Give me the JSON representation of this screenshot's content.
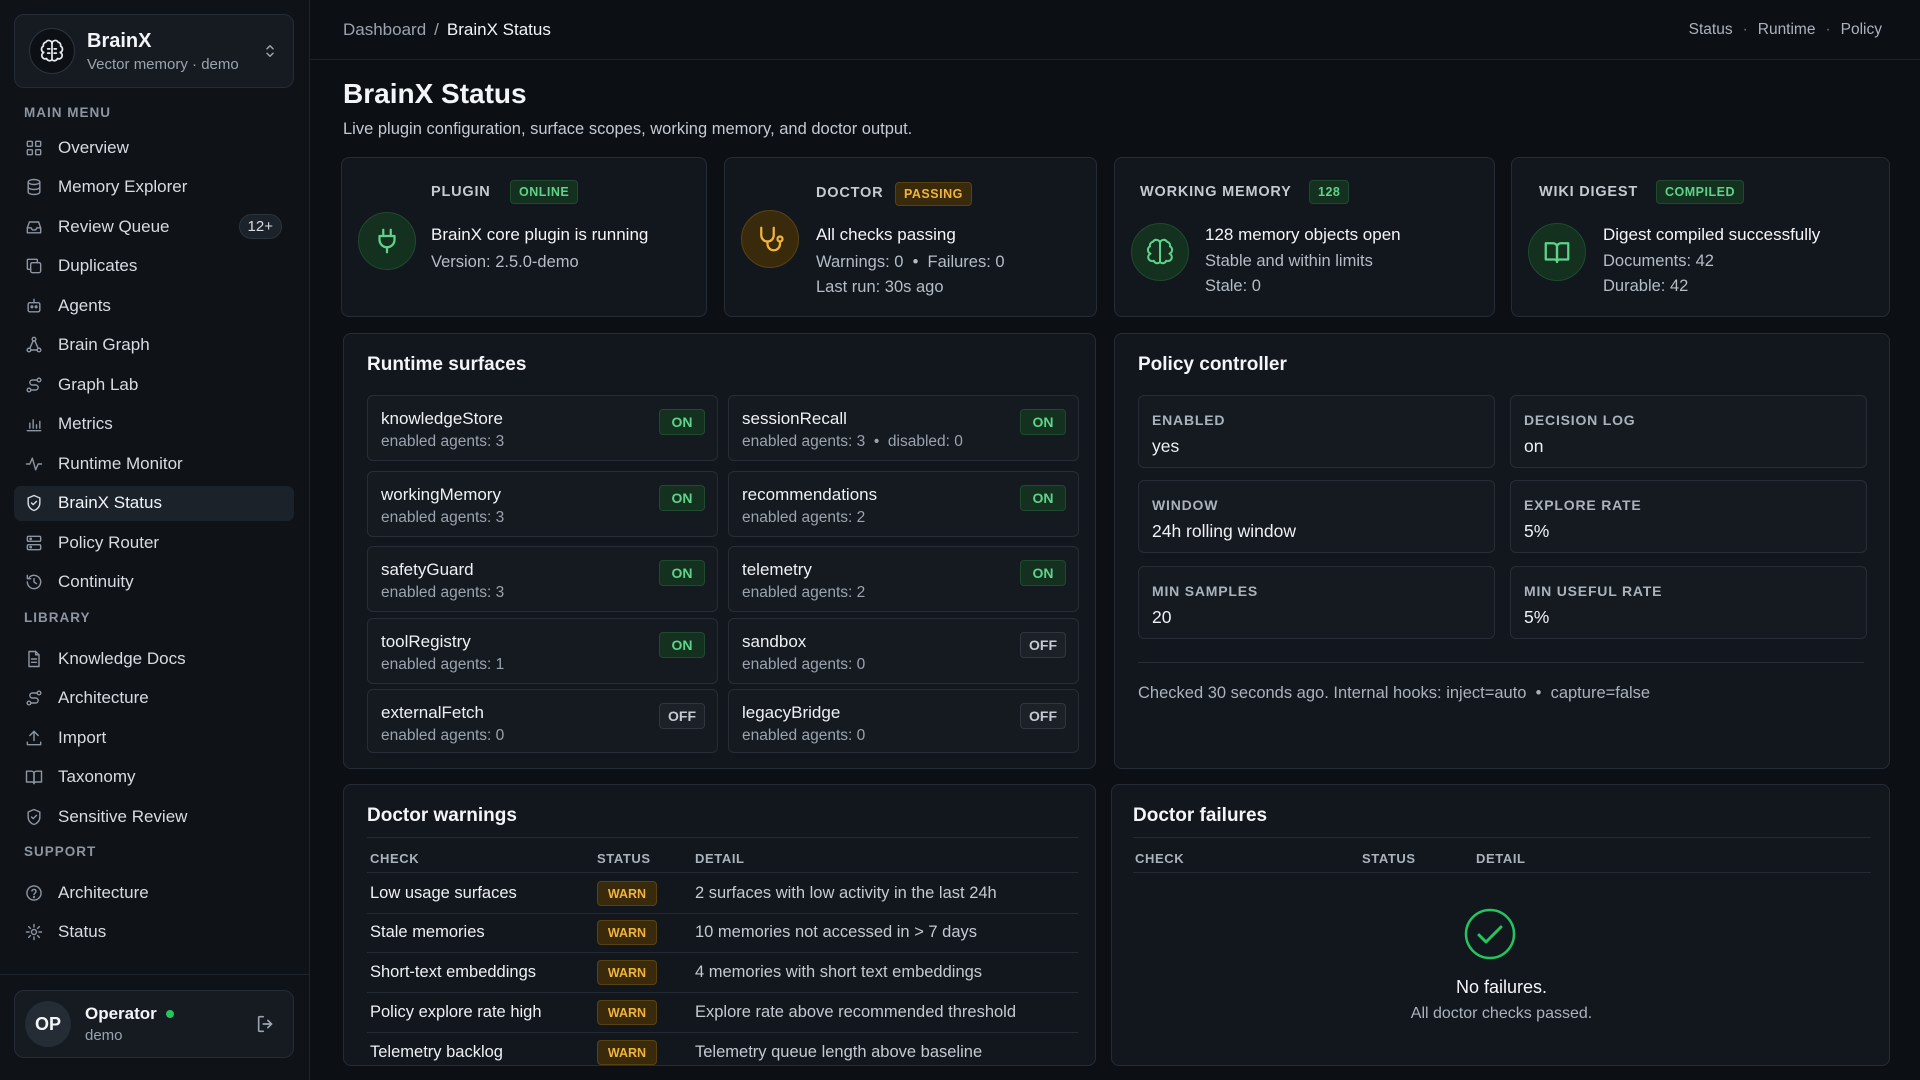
{
  "brand": {
    "name": "BrainX",
    "subtitle": "Vector memory · demo"
  },
  "sidebar": {
    "sections": {
      "main": "MAIN MENU",
      "library": "LIBRARY",
      "support": "SUPPORT"
    },
    "main": [
      {
        "label": "Overview",
        "icon": "grid-icon"
      },
      {
        "label": "Memory Explorer",
        "icon": "database-icon"
      },
      {
        "label": "Review Queue",
        "icon": "inbox-icon",
        "badge": "12+"
      },
      {
        "label": "Duplicates",
        "icon": "copy-icon"
      },
      {
        "label": "Agents",
        "icon": "bot-icon"
      },
      {
        "label": "Brain Graph",
        "icon": "network-icon"
      },
      {
        "label": "Graph Lab",
        "icon": "route-icon"
      },
      {
        "label": "Metrics",
        "icon": "bar-chart-icon"
      },
      {
        "label": "Runtime Monitor",
        "icon": "activity-icon"
      },
      {
        "label": "BrainX Status",
        "icon": "shield-icon",
        "active": true
      },
      {
        "label": "Policy Router",
        "icon": "router-icon"
      },
      {
        "label": "Continuity",
        "icon": "history-icon"
      }
    ],
    "library": [
      {
        "label": "Knowledge Docs",
        "icon": "file-text-icon"
      },
      {
        "label": "Architecture",
        "icon": "route-icon"
      },
      {
        "label": "Import",
        "icon": "upload-icon"
      },
      {
        "label": "Taxonomy",
        "icon": "book-icon"
      },
      {
        "label": "Sensitive Review",
        "icon": "shield-icon"
      }
    ],
    "support": [
      {
        "label": "Architecture",
        "icon": "help-circle-icon"
      },
      {
        "label": "Status",
        "icon": "gear-icon"
      }
    ]
  },
  "user": {
    "initials": "OP",
    "name": "Operator",
    "role": "demo"
  },
  "header": {
    "breadcrumb": [
      "Dashboard",
      "BrainX Status"
    ],
    "links": [
      "Status",
      "Runtime",
      "Policy"
    ]
  },
  "page": {
    "title": "BrainX Status",
    "subtitle": "Live plugin configuration, surface scopes, working memory, and doctor output."
  },
  "stats": {
    "plugin": {
      "label": "PLUGIN",
      "badge": "ONLINE",
      "main": "BrainX core plugin is running",
      "line1": "Version: 2.5.0-demo"
    },
    "doctor": {
      "label": "DOCTOR",
      "badge": "PASSING",
      "main": "All checks passing",
      "line1": "Warnings: 0  •  Failures: 0",
      "line2": "Last run: 30s ago"
    },
    "working_memory": {
      "label": "WORKING MEMORY",
      "badge": "128",
      "main": "128 memory objects open",
      "line1": "Stable and within limits",
      "line2": "Stale: 0"
    },
    "wiki": {
      "label": "WIKI DIGEST",
      "badge": "COMPILED",
      "main": "Digest compiled successfully",
      "line1": "Documents: 42",
      "line2": "Durable: 42"
    }
  },
  "runtime": {
    "title": "Runtime surfaces",
    "surfaces": [
      {
        "name": "knowledgeStore",
        "meta": "enabled agents: 3",
        "state": "ON"
      },
      {
        "name": "sessionRecall",
        "meta": "enabled agents: 3  •  disabled: 0",
        "state": "ON"
      },
      {
        "name": "workingMemory",
        "meta": "enabled agents: 3",
        "state": "ON"
      },
      {
        "name": "recommendations",
        "meta": "enabled agents: 2",
        "state": "ON"
      },
      {
        "name": "safetyGuard",
        "meta": "enabled agents: 3",
        "state": "ON"
      },
      {
        "name": "telemetry",
        "meta": "enabled agents: 2",
        "state": "ON"
      },
      {
        "name": "toolRegistry",
        "meta": "enabled agents: 1",
        "state": "ON"
      },
      {
        "name": "sandbox",
        "meta": "enabled agents: 0",
        "state": "OFF"
      },
      {
        "name": "externalFetch",
        "meta": "enabled agents: 0",
        "state": "OFF"
      },
      {
        "name": "legacyBridge",
        "meta": "enabled agents: 0",
        "state": "OFF"
      }
    ]
  },
  "policy": {
    "title": "Policy controller",
    "fields": [
      {
        "label": "ENABLED",
        "value": "yes"
      },
      {
        "label": "DECISION LOG",
        "value": "on"
      },
      {
        "label": "WINDOW",
        "value": "24h rolling window"
      },
      {
        "label": "EXPLORE RATE",
        "value": "5%"
      },
      {
        "label": "MIN SAMPLES",
        "value": "20"
      },
      {
        "label": "MIN USEFUL RATE",
        "value": "5%"
      }
    ],
    "note": "Checked 30 seconds ago. Internal hooks: inject=auto  •  capture=false"
  },
  "warnings": {
    "title": "Doctor warnings",
    "columns": [
      "CHECK",
      "STATUS",
      "DETAIL"
    ],
    "rows": [
      {
        "check": "Low usage surfaces",
        "status": "WARN",
        "detail": "2 surfaces with low activity in the last 24h"
      },
      {
        "check": "Stale memories",
        "status": "WARN",
        "detail": "10 memories not accessed in > 7 days"
      },
      {
        "check": "Short-text embeddings",
        "status": "WARN",
        "detail": "4 memories with short text embeddings"
      },
      {
        "check": "Policy explore rate high",
        "status": "WARN",
        "detail": "Explore rate above recommended threshold"
      },
      {
        "check": "Telemetry backlog",
        "status": "WARN",
        "detail": "Telemetry queue length above baseline"
      }
    ]
  },
  "failures": {
    "title": "Doctor failures",
    "columns": [
      "CHECK",
      "STATUS",
      "DETAIL"
    ],
    "empty_title": "No failures.",
    "empty_sub": "All doctor checks passed."
  },
  "colors": {
    "background": "#0c1015",
    "card": "#12171d",
    "success": "#22c55e",
    "warning": "#f0b43c"
  }
}
